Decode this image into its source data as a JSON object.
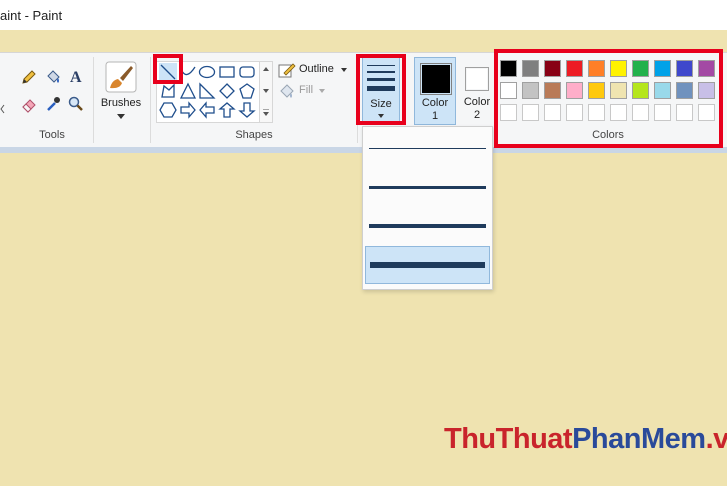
{
  "window": {
    "title": "aint - Paint"
  },
  "ribbon": {
    "tools_label": "Tools",
    "brushes_label": "Brushes",
    "shapes_label": "Shapes",
    "outline_label": "Outline",
    "fill_label": "Fill",
    "size_label": "Size",
    "color1_label_line1": "Color",
    "color1_label_line2": "1",
    "color2_label_line1": "Color",
    "color2_label_line2": "2",
    "colors_label": "Colors",
    "color1_value": "#000000",
    "color2_value": "#ffffff"
  },
  "palette": {
    "row1": [
      "#000000",
      "#7f7f7f",
      "#880015",
      "#ed1c24",
      "#ff7f27",
      "#fff200",
      "#22b14c",
      "#00a2e8",
      "#3f48cc",
      "#a349a4"
    ],
    "row2": [
      "#ffffff",
      "#c3c3c3",
      "#b97a57",
      "#ffaec9",
      "#ffc90e",
      "#efe4b0",
      "#b5e61d",
      "#99d9ea",
      "#7092be",
      "#c8bfe7"
    ],
    "row3": [
      "#ffffff",
      "#ffffff",
      "#ffffff",
      "#ffffff",
      "#ffffff",
      "#ffffff",
      "#ffffff",
      "#ffffff",
      "#ffffff",
      "#ffffff"
    ]
  },
  "size_dropdown": {
    "options": [
      1,
      3,
      5,
      8
    ],
    "selected_index": 3
  },
  "watermark": {
    "part1": "ThuThuat",
    "part2": "PhanMem",
    "part3": ".vn"
  },
  "highlight_color": "#e8001c",
  "canvas_color": "#efe3b0"
}
